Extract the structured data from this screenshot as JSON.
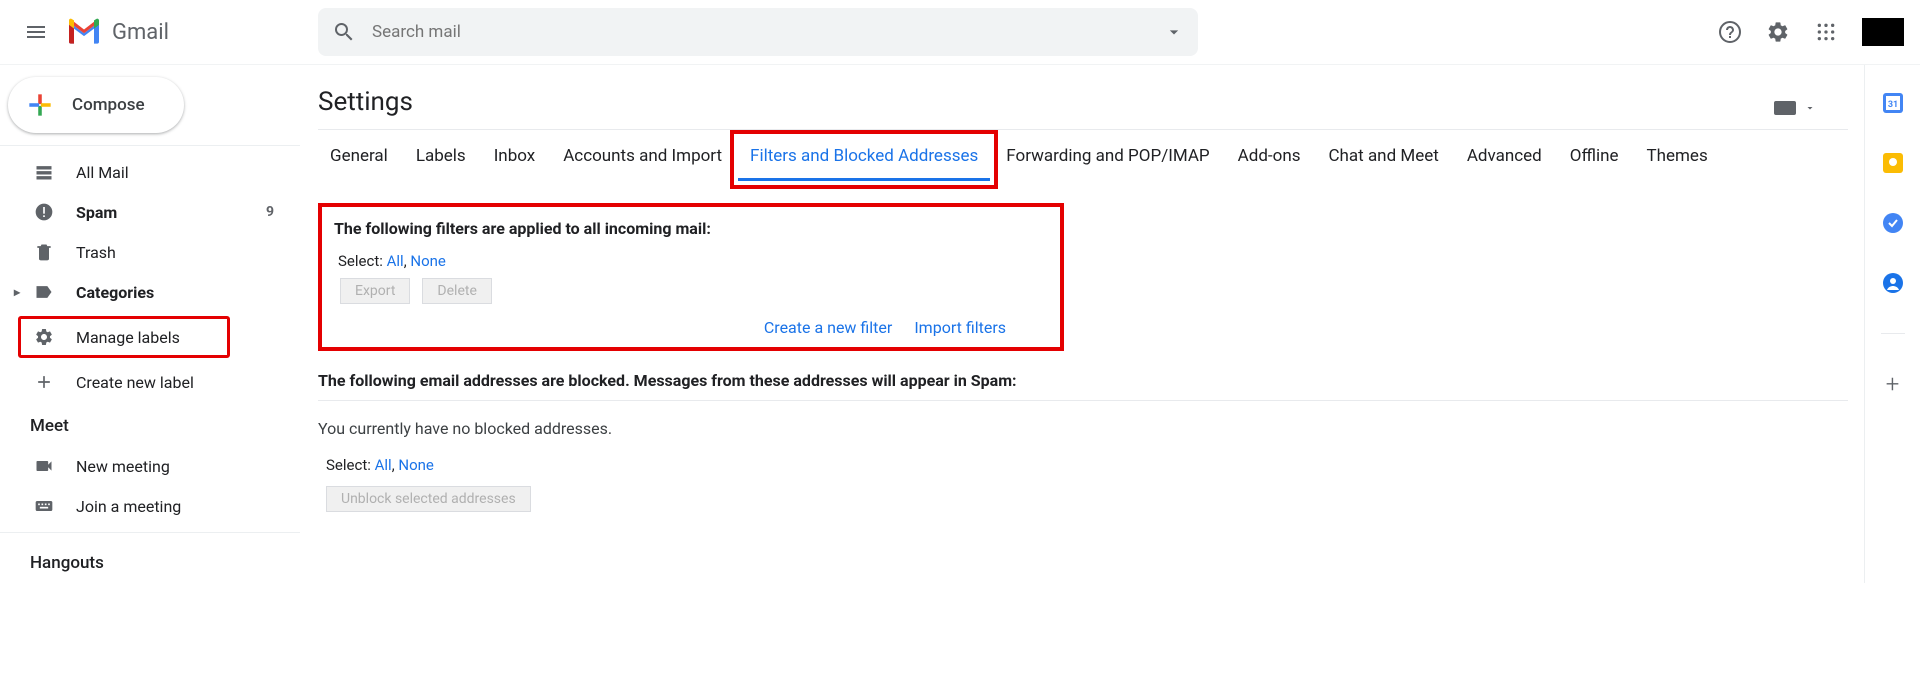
{
  "header": {
    "app_name": "Gmail",
    "search_placeholder": "Search mail"
  },
  "sidebar": {
    "compose": "Compose",
    "items": [
      {
        "label": "All Mail",
        "icon": "layers",
        "bold": false
      },
      {
        "label": "Spam",
        "icon": "spam",
        "bold": true,
        "badge": "9"
      },
      {
        "label": "Trash",
        "icon": "trash",
        "bold": false
      },
      {
        "label": "Categories",
        "icon": "label",
        "bold": true,
        "expand": true
      },
      {
        "label": "Manage labels",
        "icon": "gear",
        "bold": false,
        "highlight": true
      },
      {
        "label": "Create new label",
        "icon": "plus",
        "bold": false
      }
    ],
    "meet_header": "Meet",
    "meet_items": [
      {
        "label": "New meeting",
        "icon": "camera"
      },
      {
        "label": "Join a meeting",
        "icon": "keyboard"
      }
    ],
    "hangouts_header": "Hangouts"
  },
  "settings": {
    "title": "Settings",
    "tabs": [
      "General",
      "Labels",
      "Inbox",
      "Accounts and Import",
      "Filters and Blocked Addresses",
      "Forwarding and POP/IMAP",
      "Add-ons",
      "Chat and Meet",
      "Advanced",
      "Offline",
      "Themes"
    ],
    "active_tab_index": 4,
    "filters": {
      "heading": "The following filters are applied to all incoming mail:",
      "select_label": "Select:",
      "all": "All",
      "none": "None",
      "export": "Export",
      "delete": "Delete",
      "create_new": "Create a new filter",
      "import": "Import filters"
    },
    "blocked": {
      "heading": "The following email addresses are blocked. Messages from these addresses will appear in Spam:",
      "empty_msg": "You currently have no blocked addresses.",
      "select_label": "Select:",
      "all": "All",
      "none": "None",
      "unblock": "Unblock selected addresses"
    }
  }
}
